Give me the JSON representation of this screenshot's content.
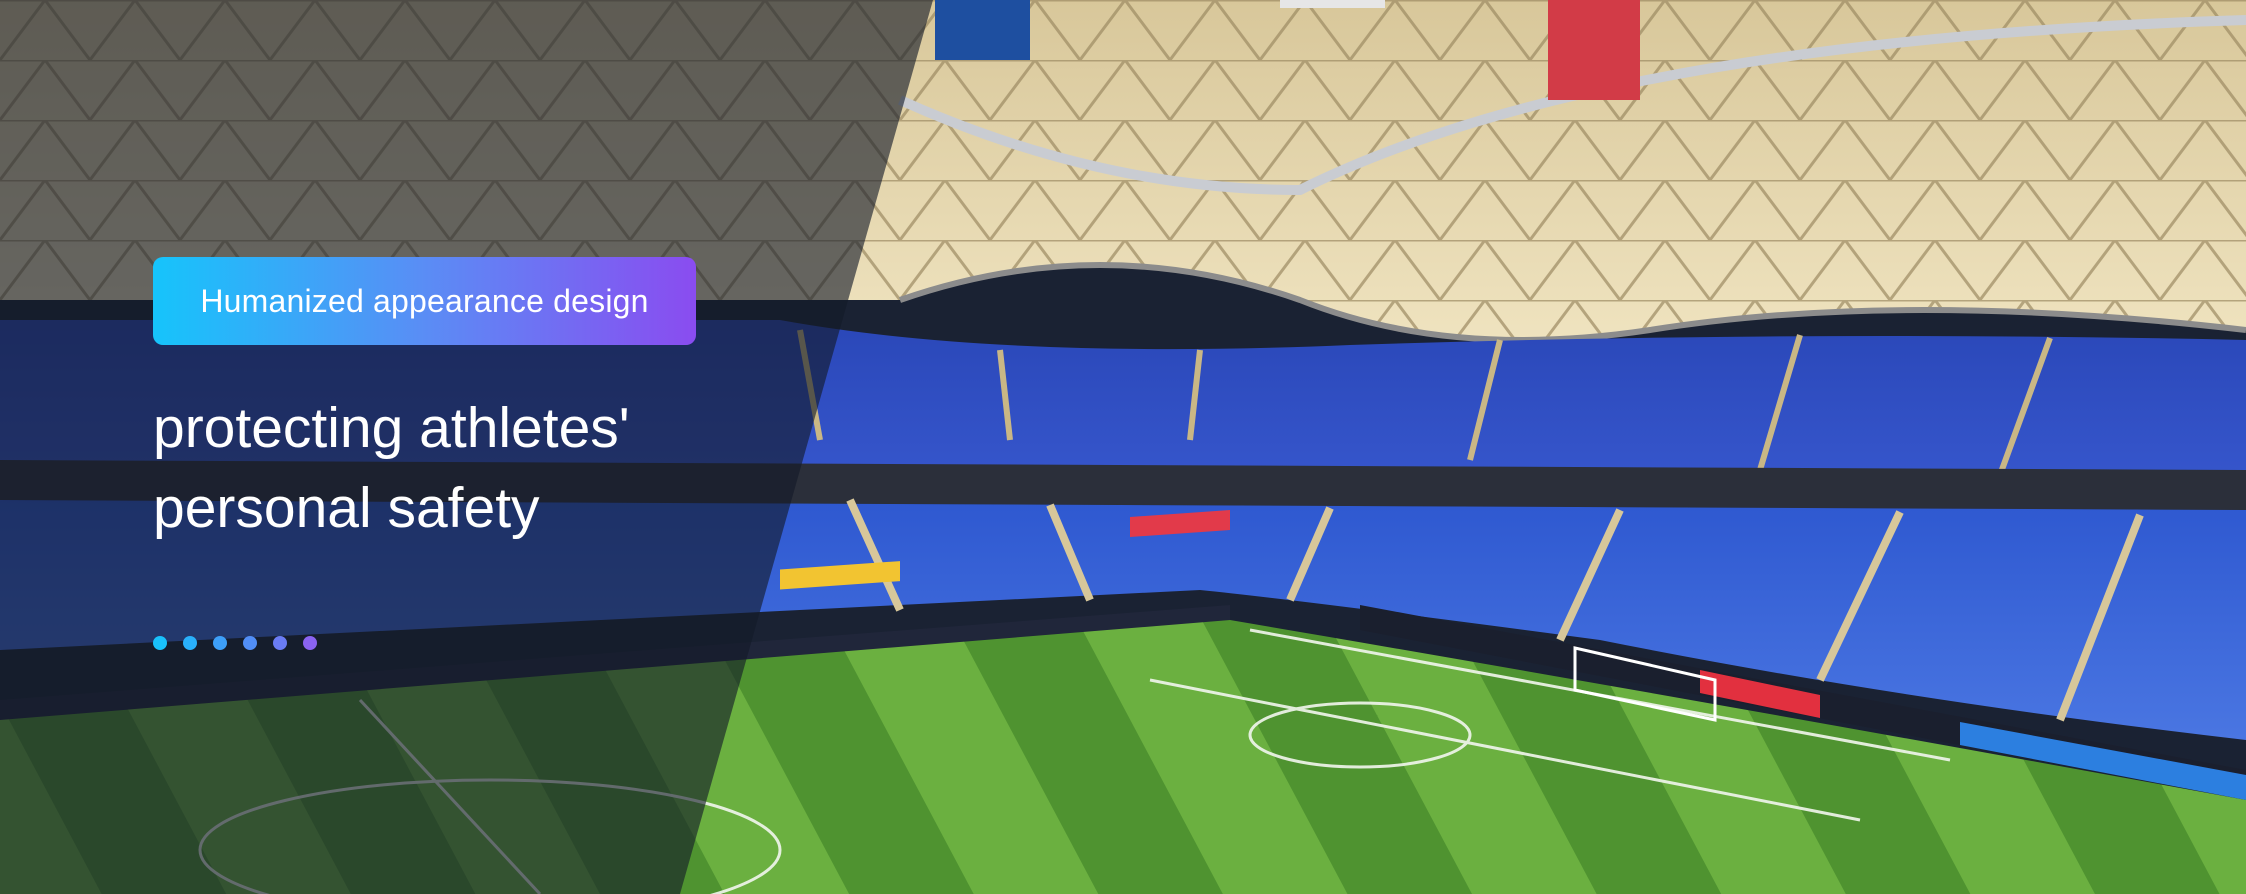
{
  "hero": {
    "badge_label": "Humanized appearance design",
    "headline_line1": "protecting athletes'",
    "headline_line2": "personal safety",
    "background": "stadium-photo"
  },
  "carousel": {
    "slide_count": 6,
    "dot_colors": [
      "#19c1fb",
      "#29b0fa",
      "#3d9ff8",
      "#518ef6",
      "#6a7cf4",
      "#8a63f1"
    ]
  },
  "colors": {
    "badge_gradient_start": "#16c4fb",
    "badge_gradient_end": "#8a4cf0",
    "overlay": "#141a28",
    "text": "#ffffff"
  }
}
